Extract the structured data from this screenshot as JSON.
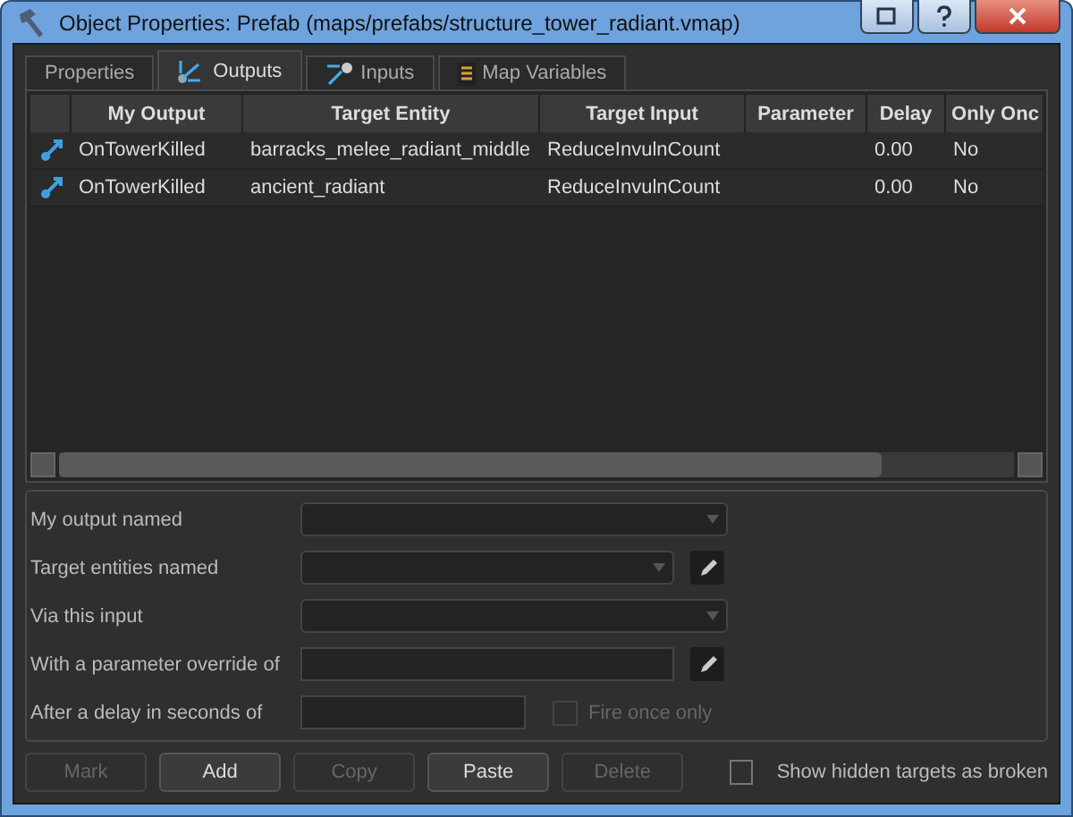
{
  "window": {
    "title": "Object Properties: Prefab (maps/prefabs/structure_tower_radiant.vmap)"
  },
  "tabs": [
    {
      "label": "Properties",
      "selected": false
    },
    {
      "label": "Outputs",
      "selected": true
    },
    {
      "label": "Inputs",
      "selected": false
    },
    {
      "label": "Map Variables",
      "selected": false
    }
  ],
  "table": {
    "columns": [
      "My Output",
      "Target Entity",
      "Target Input",
      "Parameter",
      "Delay",
      "Only Onc"
    ],
    "rows": [
      {
        "cells": [
          "OnTowerKilled",
          "barracks_melee_radiant_middle",
          "ReduceInvulnCount",
          "",
          "0.00",
          "No"
        ]
      },
      {
        "cells": [
          "OnTowerKilled",
          "ancient_radiant",
          "ReduceInvulnCount",
          "",
          "0.00",
          "No"
        ]
      }
    ]
  },
  "form": {
    "fields": [
      {
        "label": "My output named",
        "kind": "dropdown"
      },
      {
        "label": "Target entities named",
        "kind": "combo"
      },
      {
        "label": "Via this input",
        "kind": "dropdown"
      },
      {
        "label": "With a parameter override of",
        "kind": "text"
      },
      {
        "label": "After a delay in seconds of",
        "kind": "short"
      }
    ],
    "fire_once": {
      "label": "Fire once only",
      "checked": false,
      "disabled": true
    }
  },
  "buttons": [
    {
      "label": "Mark",
      "disabled": true
    },
    {
      "label": "Add",
      "disabled": false
    },
    {
      "label": "Copy",
      "disabled": true
    },
    {
      "label": "Paste",
      "disabled": false
    },
    {
      "label": "Delete",
      "disabled": true
    }
  ],
  "show_hidden": {
    "label": "Show hidden targets as broken",
    "checked": false
  }
}
